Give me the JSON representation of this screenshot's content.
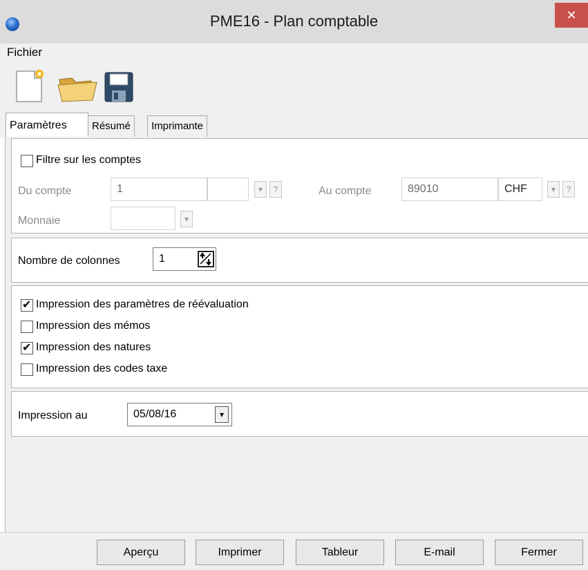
{
  "window": {
    "title": "PME16 - Plan comptable",
    "close_glyph": "✕"
  },
  "menu": {
    "items": [
      {
        "label": "Fichier"
      }
    ]
  },
  "toolbar": {
    "icons": [
      "new-document-icon",
      "open-folder-icon",
      "save-disk-icon"
    ]
  },
  "tabs": [
    {
      "label": "Paramètres",
      "active": true
    },
    {
      "label": "Résumé",
      "active": false
    },
    {
      "label": "Imprimante",
      "active": false
    }
  ],
  "filter": {
    "checkbox_label": "Filtre sur les comptes",
    "checked": false,
    "from_label": "Du compte",
    "from_value": "1",
    "from_currency": "",
    "to_label": "Au compte",
    "to_value": "89010",
    "to_currency": "CHF",
    "currency_label": "Monnaie",
    "currency_value": "",
    "dropdown_glyph": "▾",
    "help_glyph": "?"
  },
  "columns": {
    "label": "Nombre de colonnes",
    "value": "1"
  },
  "print_options": [
    {
      "label": "Impression des paramètres de réévaluation",
      "checked": true
    },
    {
      "label": "Impression des mémos",
      "checked": false
    },
    {
      "label": "Impression des natures",
      "checked": true
    },
    {
      "label": "Impression des codes taxe",
      "checked": false
    }
  ],
  "print_date": {
    "label": "Impression au",
    "value": "05/08/16",
    "dropdown_glyph": "▾"
  },
  "buttons": {
    "preview": "Aperçu",
    "print": "Imprimer",
    "spreadsheet": "Tableur",
    "email": "E-mail",
    "close": "Fermer"
  }
}
